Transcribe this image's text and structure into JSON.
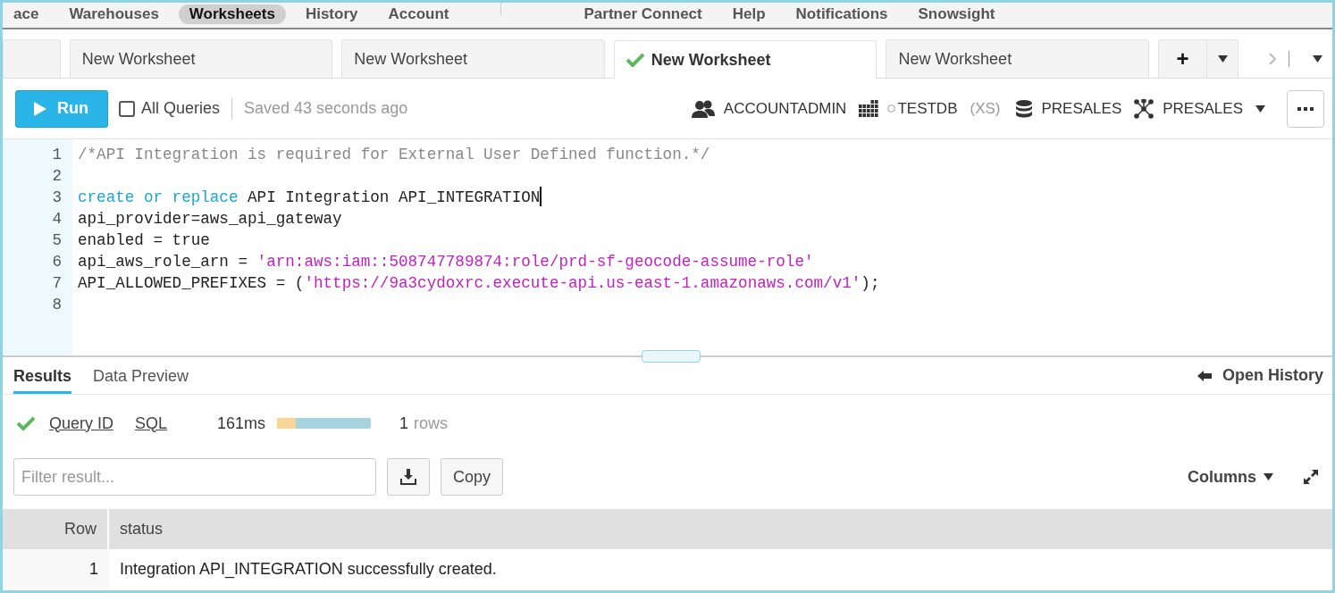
{
  "nav": [
    {
      "label": "ace",
      "selected": false
    },
    {
      "label": "Warehouses",
      "selected": false
    },
    {
      "label": "Worksheets",
      "selected": true
    },
    {
      "label": "History",
      "selected": false
    },
    {
      "label": "Account",
      "selected": false
    },
    {
      "label": "Partner Connect",
      "selected": false
    },
    {
      "label": "Help",
      "selected": false
    },
    {
      "label": "Notifications",
      "selected": false
    },
    {
      "label": "Snowsight",
      "selected": false
    }
  ],
  "tabs": [
    {
      "label": "New Worksheet",
      "selected": false,
      "saved": false
    },
    {
      "label": "New Worksheet",
      "selected": false,
      "saved": false
    },
    {
      "label": "New Worksheet",
      "selected": true,
      "saved": true
    },
    {
      "label": "New Worksheet",
      "selected": false,
      "saved": false
    }
  ],
  "add_tab": "+",
  "toolbar": {
    "run": "Run",
    "all_queries": {
      "label": "All Queries",
      "checked": false
    },
    "saved": "Saved 43 seconds ago",
    "role": "ACCOUNTADMIN",
    "warehouse": "TESTDB",
    "warehouse_size": "(XS)",
    "database": "PRESALES",
    "schema": "PRESALES"
  },
  "editor": {
    "lines": [
      {
        "number": "1",
        "tokens": [
          {
            "kind": "comment",
            "text": "/*API Integration is required for External User Defined function.*/"
          }
        ]
      },
      {
        "number": "2"
      },
      {
        "number": "3",
        "cursor": true,
        "tokens": [
          {
            "kind": "keyword",
            "text": "create or replace"
          },
          {
            "kind": "plain",
            "text": " API Integration API_INTEGRATION"
          }
        ]
      },
      {
        "number": "4",
        "tokens": [
          {
            "kind": "plain",
            "text": "api_provider=aws_api_gateway"
          }
        ]
      },
      {
        "number": "5",
        "tokens": [
          {
            "kind": "plain",
            "text": "enabled = true"
          }
        ]
      },
      {
        "number": "6",
        "tokens": [
          {
            "kind": "plain",
            "text": "api_aws_role_arn = "
          },
          {
            "kind": "string",
            "text": "'arn:aws:iam::508747789874:role/prd-sf-geocode-assume-role'"
          }
        ]
      },
      {
        "number": "7",
        "tokens": [
          {
            "kind": "plain",
            "text": "API_ALLOWED_PREFIXES = ("
          },
          {
            "kind": "string",
            "text": "'https://9a3cydoxrc.execute-api.us-east-1.amazonaws.com/v1'"
          },
          {
            "kind": "plain",
            "text": ");"
          }
        ]
      },
      {
        "number": "8"
      }
    ]
  },
  "results": {
    "tabs": [
      {
        "label": "Results",
        "selected": true
      },
      {
        "label": "Data Preview",
        "selected": false
      }
    ],
    "open_history": "Open History",
    "query": {
      "succeeded": true,
      "query_id": "Query ID",
      "sql": "SQL",
      "duration": "161ms",
      "level": 0.2,
      "row_count": "1",
      "rows_label": "rows"
    },
    "filter": {
      "placeholder": "Filter result..."
    },
    "copy": "Copy",
    "columns": "Columns",
    "table": {
      "columns": [
        "Row",
        "status"
      ],
      "rows": [
        [
          "1",
          "Integration API_INTEGRATION successfully created."
        ]
      ]
    }
  }
}
